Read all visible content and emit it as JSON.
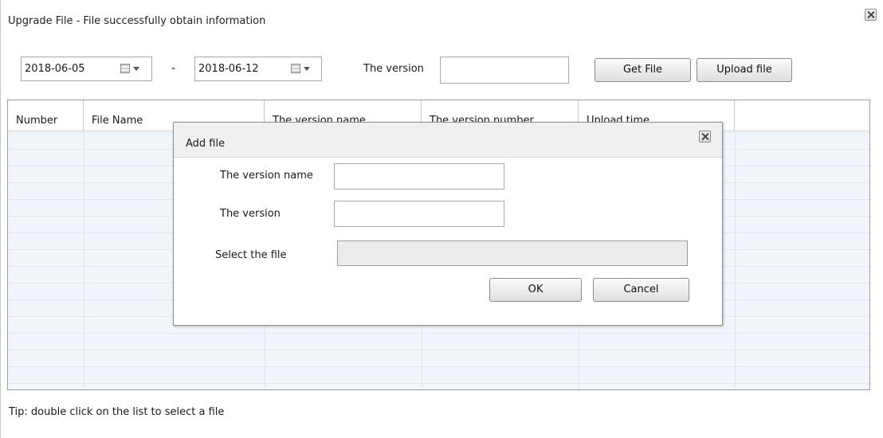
{
  "window": {
    "title": "Upgrade File - File successfully obtain information"
  },
  "filters": {
    "start_date": "2018-06-05",
    "separator": "-",
    "end_date": "2018-06-12",
    "version_label": "The version",
    "version_value": "",
    "get_file_label": "Get File",
    "upload_file_label": "Upload file"
  },
  "table": {
    "columns": [
      "Number",
      "File Name",
      "The version name",
      "The version number",
      "Upload time",
      ""
    ],
    "rows": []
  },
  "tip": "Tip: double click on the list to select a file",
  "dialog": {
    "title": "Add file",
    "version_name_label": "The version name",
    "version_name_value": "",
    "version_label": "The version",
    "version_value": "",
    "select_file_label": "Select the file",
    "select_file_value": "",
    "ok_label": "OK",
    "cancel_label": "Cancel"
  },
  "icons": {
    "close": "close-icon",
    "calendar": "calendar-icon",
    "dropdown": "chevron-down-icon",
    "folder": "folder-icon"
  }
}
